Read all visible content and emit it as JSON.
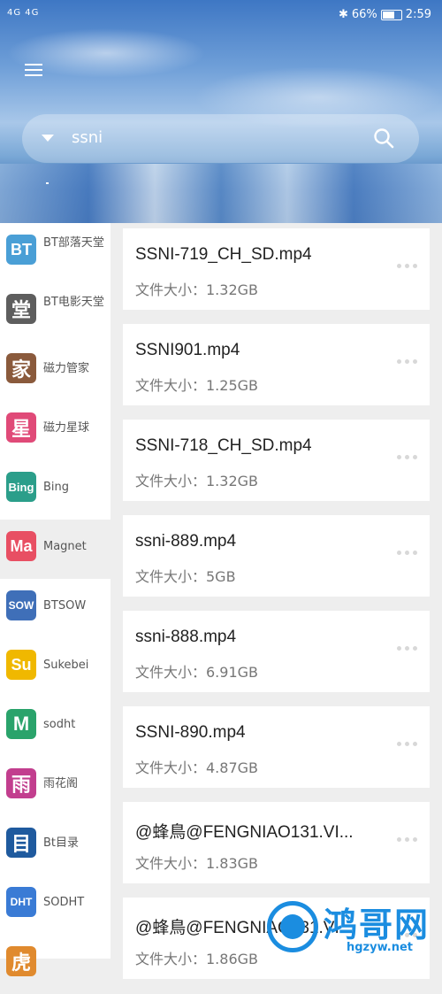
{
  "status_bar": {
    "signal_text": "4G 4G",
    "battery_percent": "66%",
    "battery_level": 0.66,
    "time": "2:59"
  },
  "search": {
    "query": "ssni"
  },
  "sidebar": {
    "items": [
      {
        "icon_text": "BT",
        "label": "BT部落天堂",
        "color": "#4a9fd6",
        "active": false
      },
      {
        "icon_text": "堂",
        "label": "BT电影天堂",
        "color": "#5e5e5e",
        "active": false
      },
      {
        "icon_text": "家",
        "label": "磁力管家",
        "color": "#8a5a3c",
        "active": false
      },
      {
        "icon_text": "星",
        "label": "磁力星球",
        "color": "#e04a78",
        "active": false
      },
      {
        "icon_text": "Bing",
        "label": "Bing",
        "color": "#2b9e8a",
        "active": false
      },
      {
        "icon_text": "Ma",
        "label": "Magnet",
        "color": "#e84f63",
        "active": true
      },
      {
        "icon_text": "SOW",
        "label": "BTSOW",
        "color": "#3f6fb8",
        "active": false
      },
      {
        "icon_text": "Su",
        "label": "Sukebei",
        "color": "#f0b800",
        "active": false
      },
      {
        "icon_text": "M",
        "label": "sodht",
        "color": "#2aa36b",
        "active": false
      },
      {
        "icon_text": "雨",
        "label": "雨花阁",
        "color": "#c23e8e",
        "active": false
      },
      {
        "icon_text": "目",
        "label": "Bt目录",
        "color": "#1f5a9e",
        "active": false
      },
      {
        "icon_text": "DHT",
        "label": "SODHT",
        "color": "#3a7bd5",
        "active": false
      },
      {
        "icon_text": "虎",
        "label": "",
        "color": "#e08a2e",
        "active": false
      }
    ]
  },
  "results": [
    {
      "name": "SSNI-719_CH_SD.mp4",
      "size": "文件大小：1.32GB"
    },
    {
      "name": "SSNI901.mp4",
      "size": "文件大小：1.25GB"
    },
    {
      "name": "SSNI-718_CH_SD.mp4",
      "size": "文件大小：1.32GB"
    },
    {
      "name": "ssni-889.mp4",
      "size": "文件大小：5GB"
    },
    {
      "name": "ssni-888.mp4",
      "size": "文件大小：6.91GB"
    },
    {
      "name": "SSNI-890.mp4",
      "size": "文件大小：4.87GB"
    },
    {
      "name": "@蜂鳥@FENGNIAO131.VI...",
      "size": "文件大小：1.83GB"
    },
    {
      "name": "@蜂鳥@FENGNIAO131.VI...",
      "size": "文件大小：1.86GB"
    }
  ],
  "watermark": {
    "title": "鸿哥网",
    "url": "hgzyw.net"
  }
}
